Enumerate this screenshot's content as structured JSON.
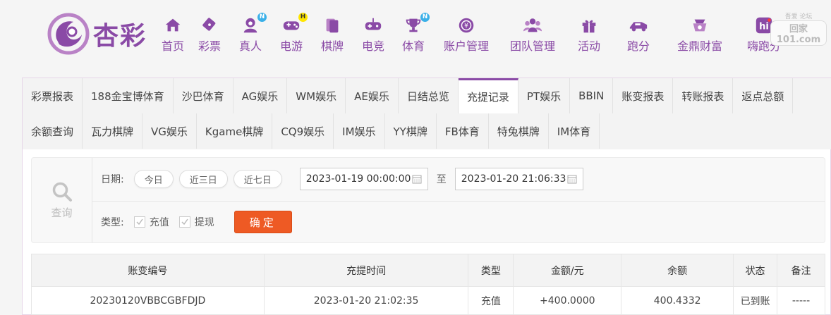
{
  "brand": {
    "name": "杏彩"
  },
  "nav": [
    {
      "label": "首页",
      "icon": "home-icon",
      "badge": ""
    },
    {
      "label": "彩票",
      "icon": "lottery-icon",
      "badge": ""
    },
    {
      "label": "真人",
      "icon": "live-dealer-icon",
      "badge": "N"
    },
    {
      "label": "电游",
      "icon": "gamepad-icon",
      "badge": "H"
    },
    {
      "label": "棋牌",
      "icon": "cards-icon",
      "badge": ""
    },
    {
      "label": "电竞",
      "icon": "esports-icon",
      "badge": ""
    },
    {
      "label": "体育",
      "icon": "trophy-icon",
      "badge": "N"
    },
    {
      "label": "账户管理",
      "icon": "account-icon",
      "badge": ""
    },
    {
      "label": "团队管理",
      "icon": "team-icon",
      "badge": ""
    },
    {
      "label": "活动",
      "icon": "gift-icon",
      "badge": ""
    },
    {
      "label": "跑分",
      "icon": "racing-icon",
      "badge": ""
    },
    {
      "label": "金鼎财富",
      "icon": "wealth-icon",
      "badge": ""
    },
    {
      "label": "嗨跑分",
      "icon": "hi-icon",
      "badge": ""
    }
  ],
  "watermark": {
    "top": "吾爱 论坛",
    "main": "回家101.com"
  },
  "tabs_row1": [
    "彩票报表",
    "188金宝博体育",
    "沙巴体育",
    "AG娱乐",
    "WM娱乐",
    "AE娱乐",
    "日结总览",
    "充提记录",
    "PT娱乐",
    "BBIN",
    "账变报表",
    "转账报表",
    "返点总额"
  ],
  "tabs_row2": [
    "余额查询",
    "瓦力棋牌",
    "VG娱乐",
    "Kgame棋牌",
    "CQ9娱乐",
    "IM娱乐",
    "YY棋牌",
    "FB体育",
    "特兔棋牌",
    "IM体育"
  ],
  "active_tab": "充提记录",
  "query": {
    "side_label": "查询",
    "date_label": "日期:",
    "quick": [
      "今日",
      "近三日",
      "近七日"
    ],
    "start": "2023-01-19 00:00:00",
    "to": "至",
    "end": "2023-01-20 21:06:33",
    "type_label": "类型:",
    "types": [
      {
        "label": "充值",
        "checked": true
      },
      {
        "label": "提现",
        "checked": true
      }
    ],
    "confirm": "确定"
  },
  "table": {
    "headers": [
      "账变编号",
      "充提时间",
      "类型",
      "金额/元",
      "余额",
      "状态",
      "备注"
    ],
    "rows": [
      [
        "20230120VBBCGBFDJD",
        "2023-01-20 21:02:35",
        "充值",
        "+400.0000",
        "400.4332",
        "已到账",
        "-----"
      ]
    ]
  },
  "colors": {
    "brand": "#8a4aa6",
    "confirm": "#ee5a24",
    "amount": "#e02020",
    "status_ok": "#2aa12a",
    "badge_n": "#3ab0e8",
    "badge_h": "#ffe600"
  }
}
